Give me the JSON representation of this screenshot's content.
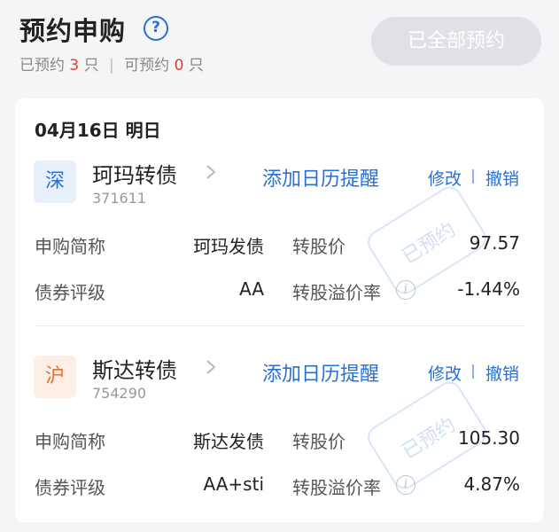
{
  "header": {
    "title": "预约申购",
    "summary": {
      "reserved_prefix": "已预约",
      "reserved_count": "3",
      "reserved_suffix": "只",
      "separator": "|",
      "available_prefix": "可预约",
      "available_count": "0",
      "available_suffix": "只"
    },
    "all_reserved_button": "已全部预约"
  },
  "card": {
    "date_line": "04月16日 明日",
    "bonds": [
      {
        "market": "深",
        "name": "珂玛转债",
        "code": "371611",
        "reminder": "添加日历提醒",
        "modify": "修改",
        "cancel": "撤销",
        "stamp": "已预约",
        "rows": [
          {
            "label": "申购简称",
            "value": "珂玛发债",
            "label2": "转股价",
            "value2": "97.57"
          },
          {
            "label": "债券评级",
            "value": "AA",
            "label2": "转股溢价率",
            "value2": "-1.44%"
          }
        ]
      },
      {
        "market": "沪",
        "name": "斯达转债",
        "code": "754290",
        "reminder": "添加日历提醒",
        "modify": "修改",
        "cancel": "撤销",
        "stamp": "已预约",
        "rows": [
          {
            "label": "申购简称",
            "value": "斯达发债",
            "label2": "转股价",
            "value2": "105.30"
          },
          {
            "label": "债券评级",
            "value": "AA+sti",
            "label2": "转股溢价率",
            "value2": "4.87%"
          }
        ]
      }
    ]
  },
  "icons": {
    "help": "help-icon",
    "chevron": "chevron-right-icon",
    "info": "info-icon"
  },
  "colors": {
    "accent": "#2a6fd6",
    "count_red": "#e03a3a",
    "sz_badge": "#2a6fd6",
    "sh_badge": "#e8702a"
  }
}
